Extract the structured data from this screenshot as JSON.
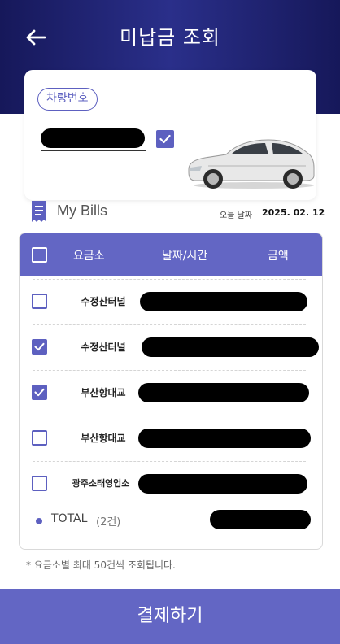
{
  "header": {
    "title": "미납금 조회",
    "back_icon": "back-arrow-icon"
  },
  "vehicle": {
    "plate_label": "차량번호",
    "plate_value_redacted": true,
    "confirmed": true
  },
  "bills": {
    "title": "My Bills",
    "date_label": "오늘 날짜",
    "date_value": "2025. 02. 12"
  },
  "table": {
    "columns": [
      "요금소",
      "날짜/시간",
      "금액"
    ],
    "rows": [
      {
        "toll": "수정산터널",
        "checked": false
      },
      {
        "toll": "수정산터널",
        "checked": true
      },
      {
        "toll": "부산항대교",
        "checked": true
      },
      {
        "toll": "부산항대교",
        "checked": false
      },
      {
        "toll": "광주소태영업소",
        "checked": false
      }
    ],
    "total_label": "TOTAL",
    "total_count": "(2건)"
  },
  "note": "* 요금소별 최대 50건씩 조회됩니다.",
  "pay_button": "결제하기",
  "colors": {
    "accent": "#6366c4",
    "header_dark": "#16185a",
    "check": "#5d60c0"
  }
}
